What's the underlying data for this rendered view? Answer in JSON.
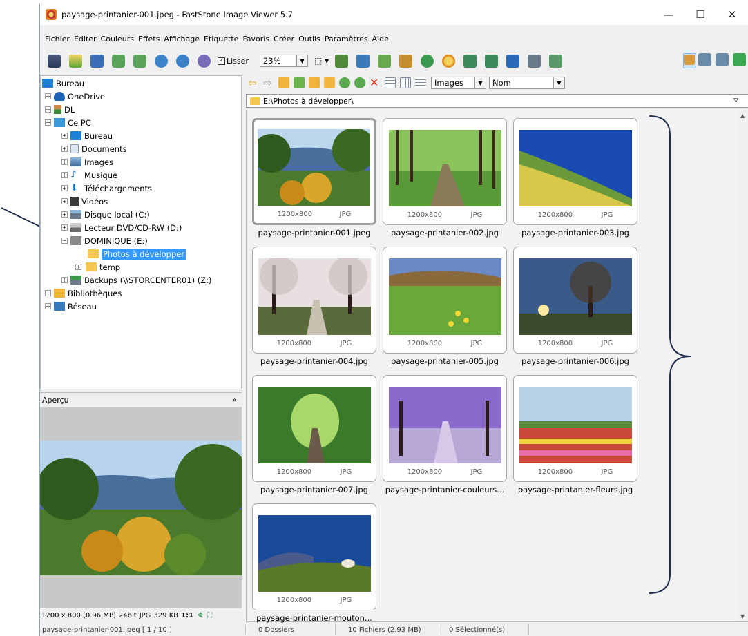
{
  "titlebar": {
    "title": "paysage-printanier-001.jpeg  -  FastStone Image Viewer 5.7",
    "minimize": "—",
    "maximize": "☐",
    "close": "✕"
  },
  "menu": [
    "Fichier",
    "Editer",
    "Couleurs",
    "Effets",
    "Affichage",
    "Etiquette",
    "Favoris",
    "Créer",
    "Outils",
    "Paramètres",
    "Aide"
  ],
  "toolbar": {
    "lisser_label": "Lisser",
    "lisser_checked": "✓",
    "zoom_value": "23%",
    "select_tool": "⬚ ▾"
  },
  "tree": {
    "items": [
      {
        "label": "Bureau"
      },
      {
        "label": "OneDrive"
      },
      {
        "label": "DL"
      },
      {
        "label": "Ce PC"
      },
      {
        "label": "Bureau"
      },
      {
        "label": "Documents"
      },
      {
        "label": "Images"
      },
      {
        "label": "Musique"
      },
      {
        "label": "Téléchargements"
      },
      {
        "label": "Vidéos"
      },
      {
        "label": "Disque local (C:)"
      },
      {
        "label": "Lecteur DVD/CD-RW (D:)"
      },
      {
        "label": "DOMINIQUE (E:)"
      },
      {
        "label": "Photos à développer"
      },
      {
        "label": "temp"
      },
      {
        "label": "Backups (\\\\STORCENTER01) (Z:)"
      },
      {
        "label": "Bibliothèques"
      },
      {
        "label": "Réseau"
      }
    ]
  },
  "preview": {
    "header": "Aperçu",
    "collapse": "»",
    "info_dims": "1200 x 800 (0.96 MP)",
    "info_bits": "24bit",
    "info_type": "JPG",
    "info_size": "329 KB",
    "info_ratio": "1:1"
  },
  "nav": {
    "view_combo": "Images",
    "sort_combo": "Nom"
  },
  "address": {
    "path": "E:\\Photos à développer\\"
  },
  "thumbnails": [
    {
      "name": "paysage-printanier-001.jpeg",
      "dims": "1200x800",
      "type": "JPG",
      "selected": true
    },
    {
      "name": "paysage-printanier-002.jpg",
      "dims": "1200x800",
      "type": "JPG"
    },
    {
      "name": "paysage-printanier-003.jpg",
      "dims": "1200x800",
      "type": "JPG"
    },
    {
      "name": "paysage-printanier-004.jpg",
      "dims": "1200x800",
      "type": "JPG"
    },
    {
      "name": "paysage-printanier-005.jpg",
      "dims": "1200x800",
      "type": "JPG"
    },
    {
      "name": "paysage-printanier-006.jpg",
      "dims": "1200x800",
      "type": "JPG"
    },
    {
      "name": "paysage-printanier-007.jpg",
      "dims": "1200x800",
      "type": "JPG"
    },
    {
      "name": "paysage-printanier-couleurs...",
      "dims": "1200x800",
      "type": "JPG"
    },
    {
      "name": "paysage-printanier-fleurs.jpg",
      "dims": "1200x800",
      "type": "JPG"
    },
    {
      "name": "paysage-printanier-mouton...",
      "dims": "1200x800",
      "type": "JPG"
    }
  ],
  "status": {
    "file": "paysage-printanier-001.jpeg [ 1 / 10 ]",
    "folders": "0 Dossiers",
    "files": "10 Fichiers (2.93 MB)",
    "selected": "0 Sélectionné(s)"
  },
  "colors": {
    "selection": "#3399ff",
    "folder": "#f5c851",
    "annotation": "#1f2f4f"
  }
}
